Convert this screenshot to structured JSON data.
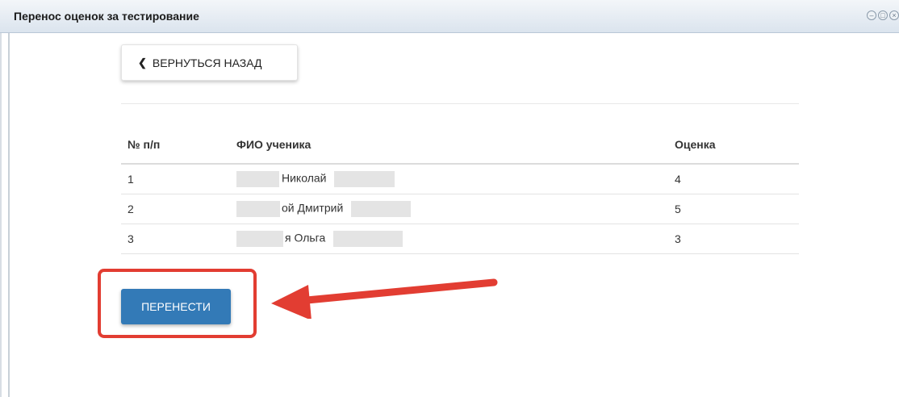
{
  "window": {
    "title": "Перенос оценок за тестирование"
  },
  "back_button": {
    "label": "ВЕРНУТЬСЯ НАЗАД",
    "icon": "chevron-left-icon"
  },
  "table": {
    "headers": [
      "№ п/п",
      "ФИО ученика",
      "Оценка"
    ],
    "rows": [
      {
        "num": "1",
        "name": "Николай",
        "grade": "4"
      },
      {
        "num": "2",
        "name": "ой Дмитрий",
        "grade": "5"
      },
      {
        "num": "3",
        "name": "я Ольга",
        "grade": "3"
      }
    ]
  },
  "transfer_button": {
    "label": "ПЕРЕНЕСТИ"
  },
  "colors": {
    "accent": "#337ab7",
    "annotation": "#e23d32"
  }
}
